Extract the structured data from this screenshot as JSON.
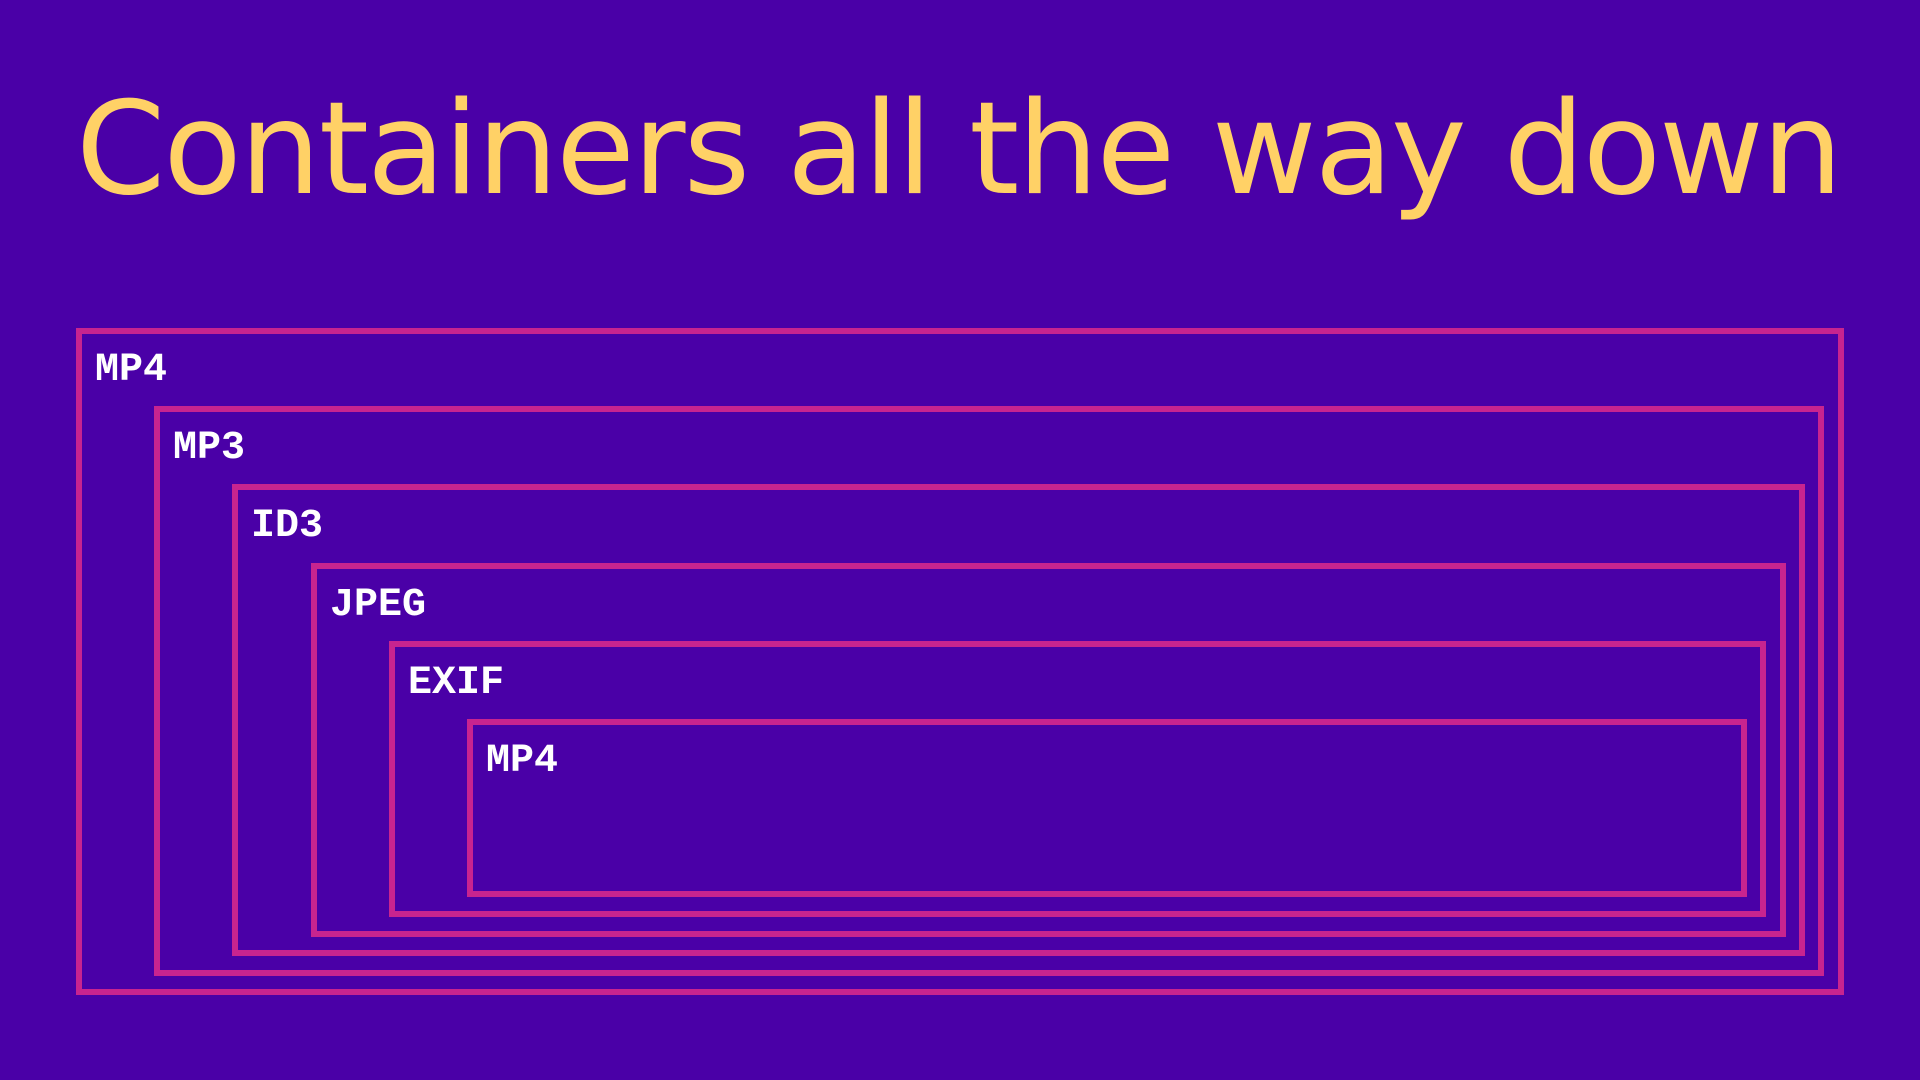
{
  "slide": {
    "title": "Containers all the way down"
  },
  "containers": [
    {
      "label": "MP4"
    },
    {
      "label": "MP3"
    },
    {
      "label": "ID3"
    },
    {
      "label": "JPEG"
    },
    {
      "label": "EXIF"
    },
    {
      "label": "MP4"
    }
  ],
  "colors": {
    "background": "#4a00a7",
    "title": "#ffd166",
    "border": "#c8248f",
    "label": "#ffffff"
  }
}
